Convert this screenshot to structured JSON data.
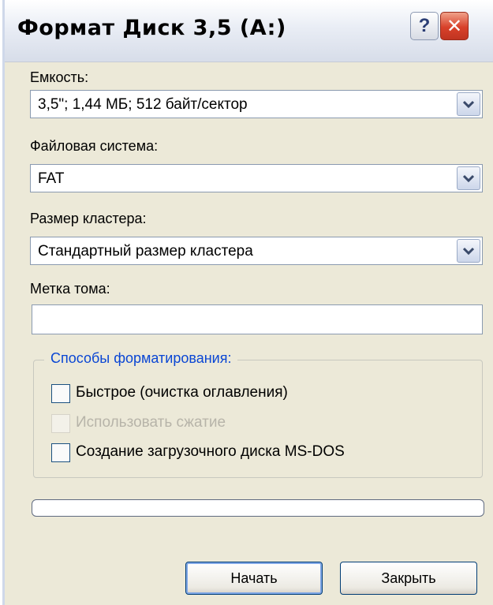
{
  "window": {
    "title": "Формат Диск 3,5 (A:)",
    "help_glyph": "?",
    "close_glyph": "✕"
  },
  "capacity": {
    "label": "Емкость:",
    "value": "3,5\"; 1,44 МБ; 512 байт/сектор"
  },
  "filesystem": {
    "label": "Файловая система:",
    "value": "FAT"
  },
  "cluster": {
    "label": "Размер кластера:",
    "value": "Стандартный размер кластера"
  },
  "volume": {
    "label": "Метка тома:",
    "value": ""
  },
  "format_options": {
    "legend": "Способы форматирования:",
    "options": [
      {
        "label": "Быстрое (очистка оглавления)",
        "checked": false,
        "enabled": true
      },
      {
        "label": "Использовать сжатие",
        "checked": false,
        "enabled": false
      },
      {
        "label": "Создание загрузочного диска MS-DOS",
        "checked": false,
        "enabled": true
      }
    ]
  },
  "progress": {
    "value": 0
  },
  "buttons": {
    "start": "Начать",
    "close": "Закрыть"
  },
  "icons": {
    "dropdown": "chevron-down-icon",
    "help": "question-icon",
    "close": "close-icon"
  },
  "colors": {
    "dialog_bg": "#ece9d8",
    "legend_text": "#0a46d4",
    "close_button": "#d8412a"
  }
}
